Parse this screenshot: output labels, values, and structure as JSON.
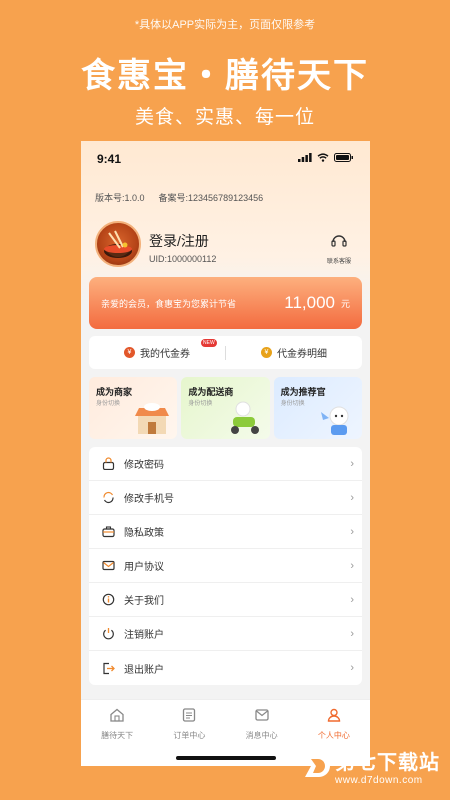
{
  "promo": {
    "disclaimer": "*具体以APP实际为主，页面仅限参考",
    "title": "食惠宝・膳待天下",
    "subtitle": "美食、实惠、每一位"
  },
  "status_bar": {
    "time": "9:41"
  },
  "profile": {
    "version": "版本号:1.0.0",
    "record": "备案号:123456789123456",
    "login_label": "登录/注册",
    "uid": "UID:1000000112",
    "support_label": "联系客服"
  },
  "savings": {
    "text": "亲爱的会员，食惠宝为您累计节省",
    "amount": "11,000",
    "unit": "元"
  },
  "coupons": {
    "my_label": "我的代金券",
    "badge": "NEW",
    "detail_label": "代金券明细"
  },
  "roles": [
    {
      "title": "成为商家",
      "sub": "身份切换"
    },
    {
      "title": "成为配送商",
      "sub": "身份切换"
    },
    {
      "title": "成为推荐官",
      "sub": "身份切换"
    }
  ],
  "menu": [
    {
      "label": "修改密码",
      "icon": "lock-icon"
    },
    {
      "label": "修改手机号",
      "icon": "refresh-phone-icon"
    },
    {
      "label": "隐私政策",
      "icon": "briefcase-icon"
    },
    {
      "label": "用户协议",
      "icon": "mail-icon"
    },
    {
      "label": "关于我们",
      "icon": "info-icon"
    },
    {
      "label": "注销账户",
      "icon": "power-icon"
    },
    {
      "label": "退出账户",
      "icon": "logout-icon"
    }
  ],
  "tabs": [
    {
      "label": "膳待天下",
      "icon": "home-icon"
    },
    {
      "label": "订单中心",
      "icon": "list-icon"
    },
    {
      "label": "消息中心",
      "icon": "message-icon"
    },
    {
      "label": "个人中心",
      "icon": "user-icon",
      "active": true
    }
  ],
  "watermark": {
    "main": "第七下载站",
    "url": "www.d7down.com"
  },
  "colors": {
    "brand": "#F7A24E",
    "accent": "#F06A2E",
    "banner_end": "#F36B3F"
  }
}
